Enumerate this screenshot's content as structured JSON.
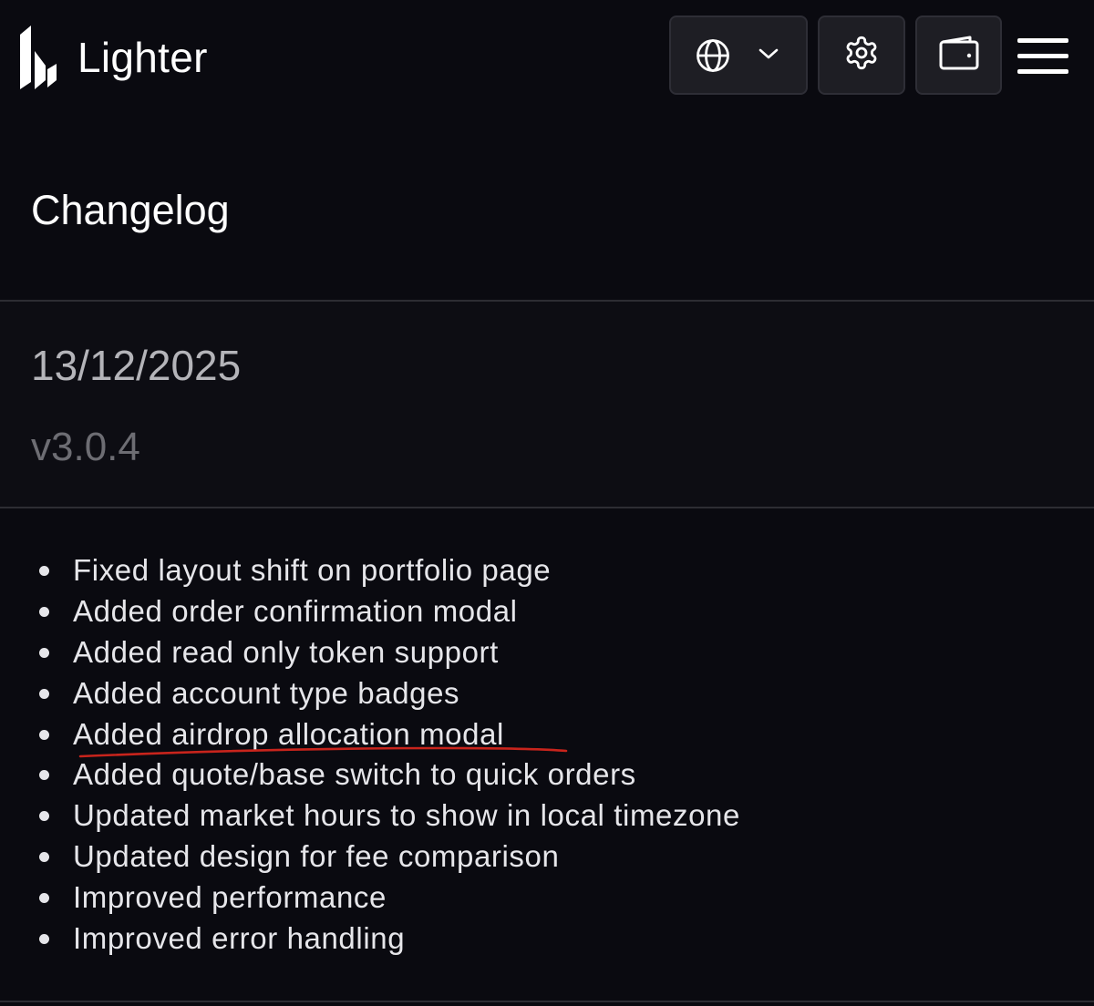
{
  "header": {
    "brand": "Lighter",
    "logo_icon": "lighter-logo-icon",
    "language_icon": "globe-icon",
    "language_chevron_icon": "chevron-down-icon",
    "settings_icon": "gear-icon",
    "wallet_icon": "wallet-icon",
    "menu_icon": "hamburger-menu-icon"
  },
  "page": {
    "title": "Changelog"
  },
  "release": {
    "date": "13/12/2025",
    "version": "v3.0.4",
    "changes": [
      "Fixed layout shift on portfolio page",
      "Added order confirmation modal",
      "Added read only token support",
      "Added account type badges",
      "Added airdrop allocation modal",
      "Added quote/base switch to quick orders",
      "Updated market hours to show in local timezone",
      "Updated design for fee comparison",
      "Improved performance",
      "Improved error handling"
    ]
  },
  "colors": {
    "background": "#0a0a10",
    "button_bg": "#1e1e24",
    "divider": "#2d2d33",
    "text_primary": "#ffffff",
    "text_date": "#b4b4b9",
    "text_version": "#6d6d73",
    "annotation_underline": "#c8241c"
  }
}
